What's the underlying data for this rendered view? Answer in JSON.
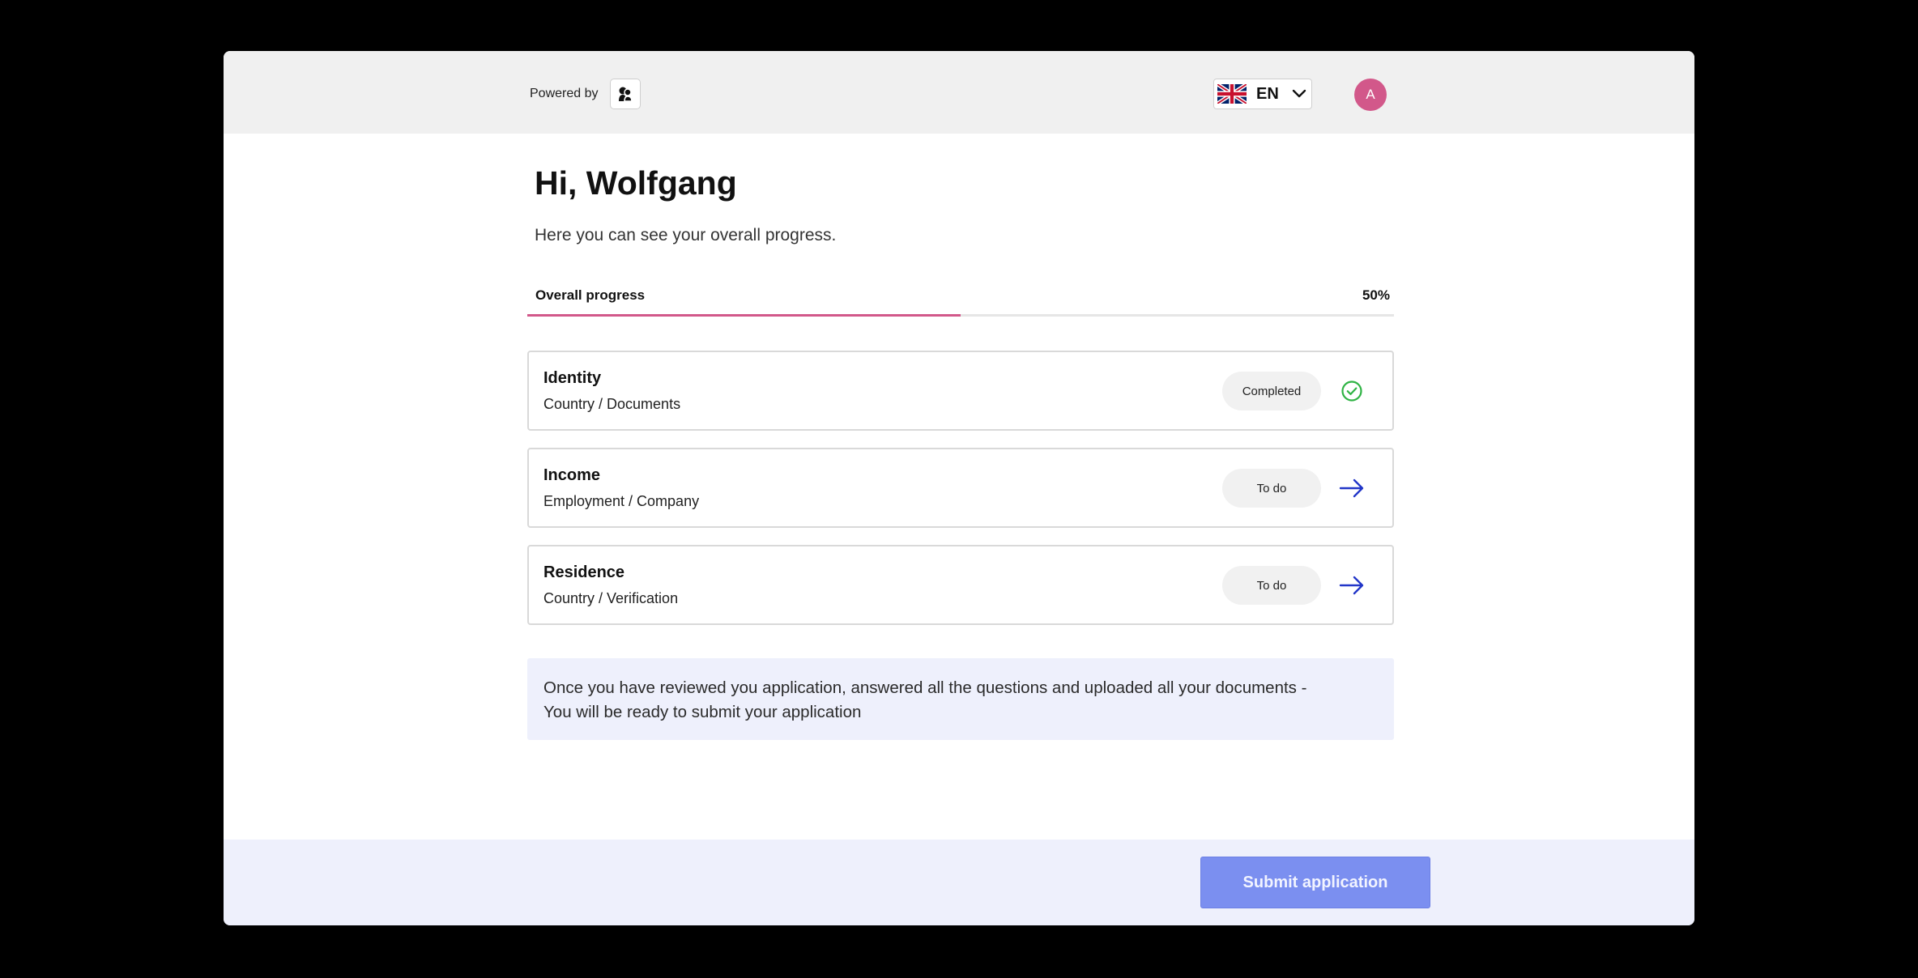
{
  "header": {
    "powered_by_label": "Powered by",
    "language": {
      "code": "EN",
      "flag": "uk-flag-icon"
    },
    "avatar_initial": "A",
    "avatar_color": "#d2588a"
  },
  "main": {
    "greeting": "Hi, Wolfgang",
    "subtitle": "Here you can see your overall progress.",
    "progress": {
      "label": "Overall progress",
      "value": 0.5,
      "value_text": "50%",
      "color": "#d2588a"
    },
    "tasks": [
      {
        "title": "Identity",
        "subtitle": "Country / Documents",
        "status": "Completed",
        "icon": "check-circle-icon"
      },
      {
        "title": "Income",
        "subtitle": "Employment / Company",
        "status": "To do",
        "icon": "arrow-right-icon"
      },
      {
        "title": "Residence",
        "subtitle": "Country / Verification",
        "status": "To do",
        "icon": "arrow-right-icon"
      }
    ],
    "info_line_1": "Once you have reviewed you application, answered all the questions and uploaded all your documents -",
    "info_line_2": "You will be ready to submit your application"
  },
  "footer": {
    "submit_label": "Submit application",
    "submit_color": "#7b8ff0"
  },
  "colors": {
    "check": "#2fb344",
    "arrow": "#2236c8",
    "accent": "#d2588a"
  }
}
